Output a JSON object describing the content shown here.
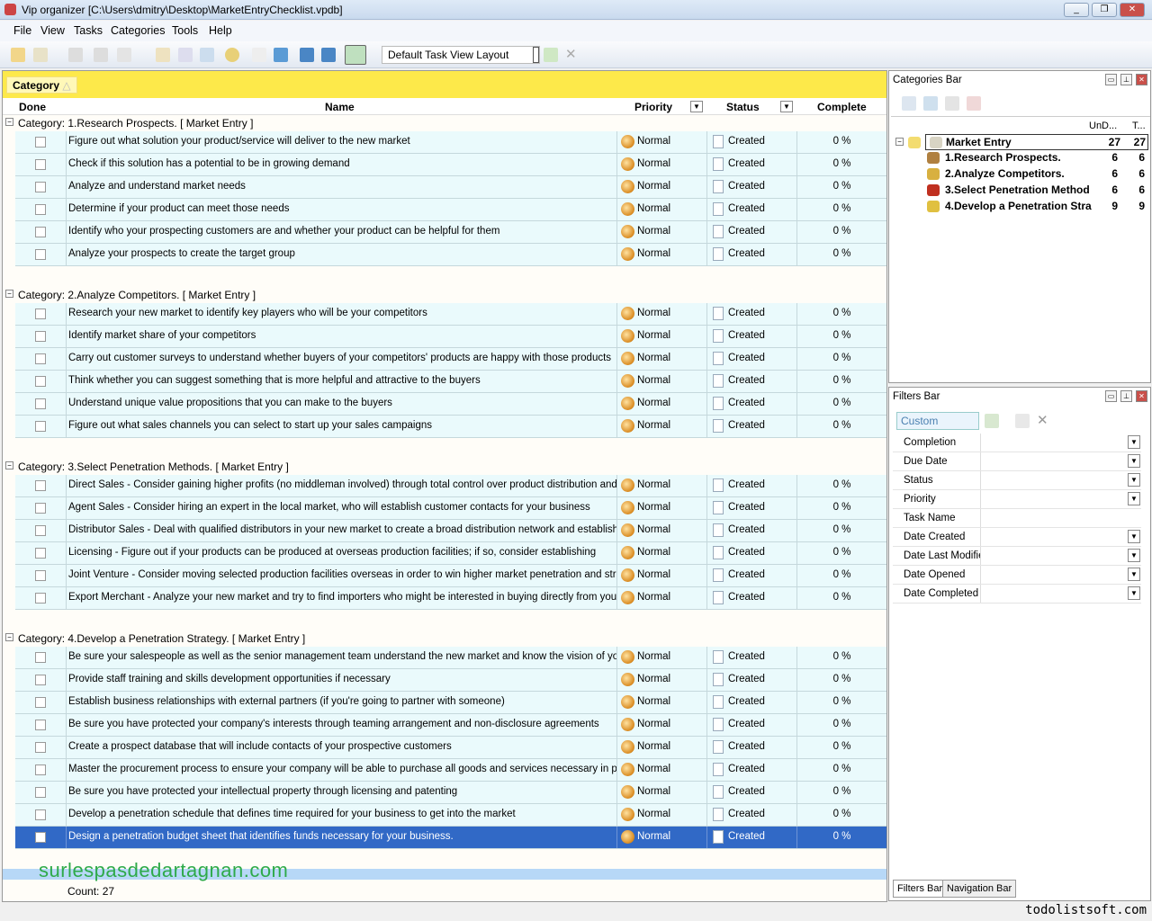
{
  "window": {
    "title": "Vip organizer [C:\\Users\\dmitry\\Desktop\\MarketEntryChecklist.vpdb]"
  },
  "menu": [
    "File",
    "View",
    "Tasks",
    "Categories",
    "Tools",
    "Help"
  ],
  "toolbar": {
    "layout_select": "Default Task View Layout"
  },
  "grid": {
    "group_by": "Category",
    "columns": {
      "done": "Done",
      "name": "Name",
      "priority": "Priority",
      "status": "Status",
      "complete": "Complete"
    },
    "groups": [
      {
        "label": "Category: 1.Research Prospects.     [ Market Entry ]",
        "tasks": [
          "Figure out what solution your product/service will deliver to the new market",
          "Check if this solution has a potential to be in growing demand",
          "Analyze and understand market needs",
          "Determine if your product can meet those needs",
          "Identify who your prospecting customers are and whether your product can be helpful for them",
          "Analyze your prospects to create the target group"
        ]
      },
      {
        "label": "Category: 2.Analyze Competitors.     [ Market Entry ]",
        "tasks": [
          "Research your new market to identify key players who will be your competitors",
          "Identify market share of your competitors",
          "Carry out customer surveys to understand whether buyers of your competitors' products are happy with those products",
          "Think whether you can suggest something that is more helpful and attractive to the buyers",
          "Understand unique value propositions that you can make to the buyers",
          "Figure out what sales channels you can select to start up your sales campaigns"
        ]
      },
      {
        "label": "Category: 3.Select Penetration Methods.     [ Market Entry ]",
        "tasks": [
          "Direct Sales - Consider gaining higher profits (no middleman involved) through total control over product distribution and pricing in",
          "Agent Sales - Consider hiring an expert in the local market, who will establish customer contacts for your business",
          "Distributor Sales - Deal with qualified distributors in your new market to create a broad distribution network and establish winning",
          "Licensing - Figure out if your products can be produced at overseas production facilities; if so, consider establishing",
          "Joint Venture - Consider moving selected production facilities overseas in order to win higher market penetration and strengthen",
          "Export Merchant - Analyze your new market and try to find importers who might be interested in buying directly from your company"
        ]
      },
      {
        "label": "Category: 4.Develop a Penetration Strategy.     [ Market Entry ]",
        "tasks": [
          "Be sure your salespeople as well as the senior management team understand the new market and know the vision of your",
          "Provide staff training and skills development opportunities if necessary",
          "Establish business relationships with external partners (if you're going to partner with someone)",
          "Be sure you have protected your company's interests through teaming arrangement and non-disclosure agreements",
          "Create a prospect database that will include contacts of your prospective customers",
          "Master the procurement process to ensure your company will be able to purchase all goods and services necessary in production",
          "Be sure you have protected your intellectual property through licensing and patenting",
          "Develop a penetration schedule that defines time required for your business to get into the market",
          "Design a penetration budget sheet that identifies funds necessary for your business."
        ]
      }
    ],
    "task_defaults": {
      "priority": "Normal",
      "status": "Created",
      "complete": "0 %",
      "done": false
    },
    "selected_task": "Design a penetration budget sheet that identifies funds necessary for your business.",
    "count": "Count: 27"
  },
  "categories_bar": {
    "title": "Categories Bar",
    "col_undone": "UnD...",
    "col_total": "T...",
    "items": [
      {
        "name": "Market Entry",
        "undone": "27",
        "total": "27",
        "icon": "book-icon"
      },
      {
        "name": "1.Research Prospects.",
        "undone": "6",
        "total": "6",
        "icon": "people-icon"
      },
      {
        "name": "2.Analyze Competitors.",
        "undone": "6",
        "total": "6",
        "icon": "coins-icon"
      },
      {
        "name": "3.Select Penetration Method",
        "undone": "6",
        "total": "6",
        "icon": "seal-icon"
      },
      {
        "name": "4.Develop a Penetration Stra",
        "undone": "9",
        "total": "9",
        "icon": "key-icon"
      }
    ]
  },
  "filters_bar": {
    "title": "Filters Bar",
    "preset": "Custom",
    "fields": [
      {
        "label": "Completion",
        "dropdown": true
      },
      {
        "label": "Due Date",
        "dropdown": true
      },
      {
        "label": "Status",
        "dropdown": true
      },
      {
        "label": "Priority",
        "dropdown": true
      },
      {
        "label": "Task Name",
        "dropdown": false
      },
      {
        "label": "Date Created",
        "dropdown": true
      },
      {
        "label": "Date Last Modified",
        "dropdown": true
      },
      {
        "label": "Date Opened",
        "dropdown": true
      },
      {
        "label": "Date Completed",
        "dropdown": true
      }
    ],
    "tabs": [
      "Filters Bar",
      "Navigation Bar"
    ]
  },
  "watermark": "surlespasdedartagnan.com",
  "footer_brand": "todolistsoft.com",
  "colors": {
    "group_bar": "#fde94a",
    "row_bg": "#eafafc",
    "selected_row": "#3169c6"
  }
}
